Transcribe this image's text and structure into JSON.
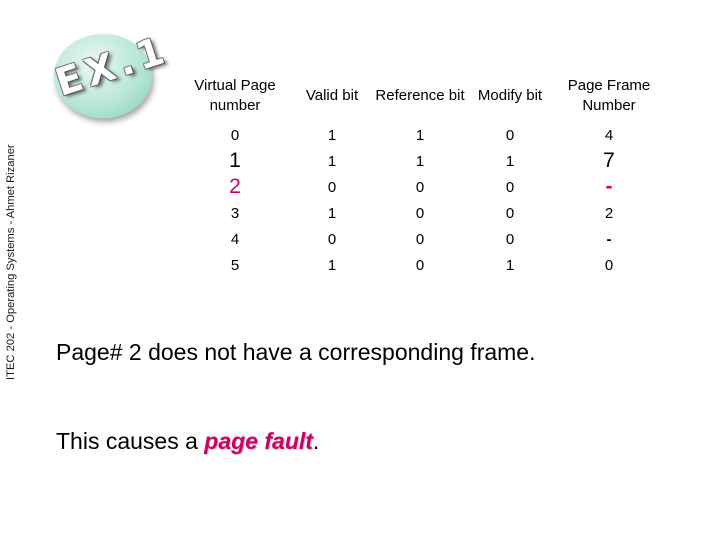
{
  "side_caption": "ITEC 202  -  Operating Systems - Ahmet Rizaner",
  "badge": {
    "label": "EX.1",
    "color": "#a8e0cc"
  },
  "table": {
    "headers": [
      "Virtual Page number",
      "Valid bit",
      "Reference bit",
      "Modify bit",
      "Page Frame Number"
    ],
    "rows": [
      [
        "0",
        "1",
        "1",
        "0",
        "4"
      ],
      [
        "1",
        "1",
        "1",
        "1",
        "7"
      ],
      [
        "2",
        "0",
        "0",
        "0",
        "-"
      ],
      [
        "3",
        "1",
        "0",
        "0",
        "2"
      ],
      [
        "4",
        "0",
        "0",
        "0",
        "-"
      ],
      [
        "5",
        "1",
        "0",
        "1",
        "0"
      ]
    ],
    "highlight_color": "#cc0066"
  },
  "text": {
    "line1": "Page# 2 does not have a corresponding frame.",
    "line2_prefix": "This causes a ",
    "line2_emphasis": "page fault",
    "line2_suffix": "."
  }
}
